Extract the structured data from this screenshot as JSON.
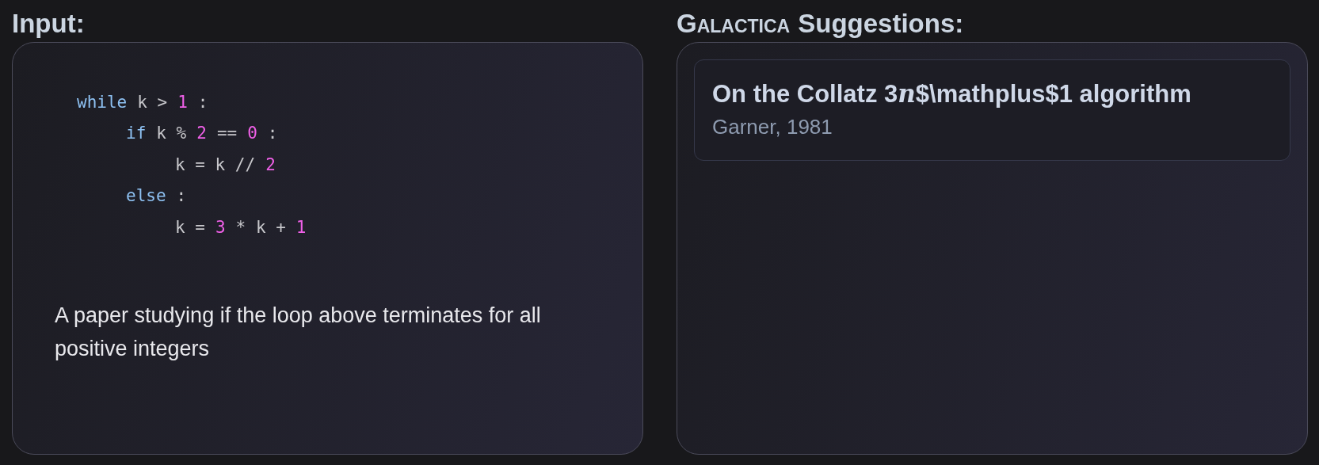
{
  "input": {
    "heading": "Input:",
    "code": [
      {
        "tokens": [
          {
            "kind": "keyword",
            "text": "while"
          },
          {
            "kind": "plain",
            "text": "k >"
          },
          {
            "kind": "number",
            "text": "1"
          },
          {
            "kind": "plain",
            "text": ":"
          }
        ],
        "children": [
          {
            "tokens": [
              {
                "kind": "keyword",
                "text": "if"
              },
              {
                "kind": "plain",
                "text": "k %"
              },
              {
                "kind": "number",
                "text": "2"
              },
              {
                "kind": "plain",
                "text": "=="
              },
              {
                "kind": "number",
                "text": "0"
              },
              {
                "kind": "plain",
                "text": ":"
              }
            ],
            "children": [
              {
                "tokens": [
                  {
                    "kind": "plain",
                    "text": "k = k //"
                  },
                  {
                    "kind": "number",
                    "text": "2"
                  }
                ]
              }
            ]
          },
          {
            "tokens": [
              {
                "kind": "keyword",
                "text": "else"
              },
              {
                "kind": "plain",
                "text": ":"
              }
            ],
            "children": [
              {
                "tokens": [
                  {
                    "kind": "plain",
                    "text": "k ="
                  },
                  {
                    "kind": "number",
                    "text": "3"
                  },
                  {
                    "kind": "plain",
                    "text": "* k +"
                  },
                  {
                    "kind": "number",
                    "text": "1"
                  }
                ]
              }
            ]
          }
        ]
      }
    ],
    "description": "A paper studying if the loop above terminates for all positive integers"
  },
  "suggestions": {
    "heading_brand": "Galactica",
    "heading": "Suggestions:",
    "items": [
      {
        "title_parts": [
          {
            "kind": "text",
            "text": "On the Collatz 3"
          },
          {
            "kind": "math",
            "text": "n"
          },
          {
            "kind": "text",
            "text": "$\\mathplus$1 algorithm"
          }
        ],
        "citation": "Garner, 1981"
      }
    ]
  }
}
